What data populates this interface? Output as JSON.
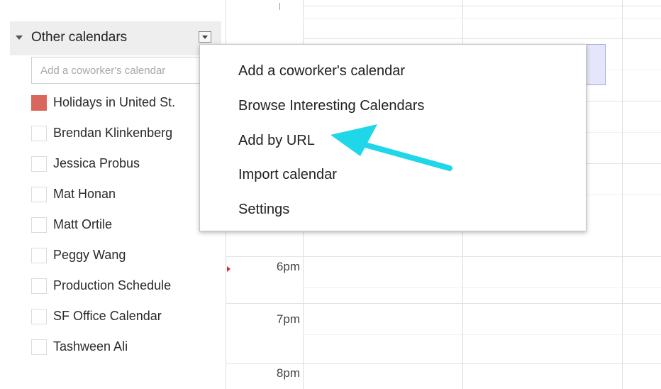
{
  "sidebar": {
    "section_title": "Other calendars",
    "coworker_input": {
      "placeholder": "Add a coworker's calendar",
      "value": ""
    },
    "calendars": [
      {
        "label": "Holidays in United St.",
        "checked": true,
        "color": "#d9675e"
      },
      {
        "label": "Brendan Klinkenberg",
        "checked": false
      },
      {
        "label": "Jessica Probus",
        "checked": false
      },
      {
        "label": "Mat Honan",
        "checked": false
      },
      {
        "label": "Matt Ortile",
        "checked": false
      },
      {
        "label": "Peggy Wang",
        "checked": false
      },
      {
        "label": "Production Schedule",
        "checked": false
      },
      {
        "label": "SF Office Calendar",
        "checked": false
      },
      {
        "label": "Tashween Ali",
        "checked": false
      }
    ]
  },
  "grid": {
    "times": [
      "6pm",
      "7pm",
      "8pm"
    ],
    "now_marker_color": "#cc3333",
    "event_color": "#e6e6fb"
  },
  "menu": {
    "items": [
      "Add a coworker's calendar",
      "Browse Interesting Calendars",
      "Add by URL",
      "Import calendar",
      "Settings"
    ]
  },
  "annotation": {
    "color": "#1fd7e8",
    "points_to": "Add by URL"
  }
}
